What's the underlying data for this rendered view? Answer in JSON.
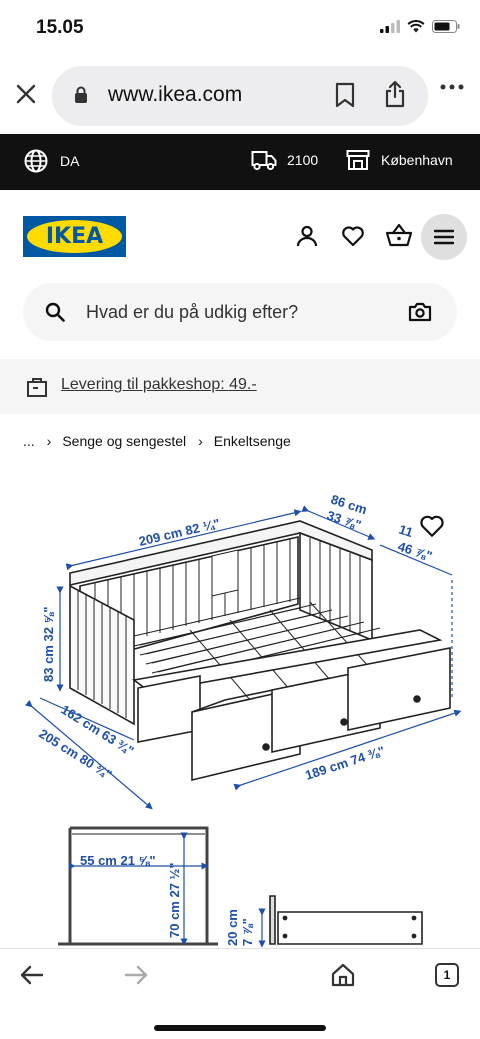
{
  "status": {
    "time": "15.05"
  },
  "browser": {
    "url": "www.ikea.com"
  },
  "topbar": {
    "language": "DA",
    "postcode": "2100",
    "store": "København"
  },
  "header": {
    "logo_text": "IKEA"
  },
  "search": {
    "placeholder": "Hvad er du på udkig efter?"
  },
  "promo": {
    "text": "Levering til pakkeshop: 49.-"
  },
  "breadcrumb": {
    "ellipsis": "...",
    "items": [
      "Senge og sengestel",
      "Enkeltsenge"
    ]
  },
  "diagram": {
    "labels": {
      "top_width": "209 cm 82 ¼\"",
      "depth_top": "86 cm",
      "depth_top_in": "33 ⅞\"",
      "depth_right": "11",
      "depth_right_in": "46 ⅞\"",
      "height": "83 cm 32 ⅝\"",
      "side_a": "162 cm 63 ¾\"",
      "side_b": "205 cm 80 ¾\"",
      "front_length": "189 cm 74 ⅜\"",
      "inner_width": "55 cm 21 ⅝\"",
      "inner_height": "70 cm 27 ½\"",
      "drawer_height": "20 cm",
      "drawer_height_in": "7 ⅞\""
    }
  },
  "bottom_nav": {
    "tabs_count": "1"
  },
  "colors": {
    "topbar": "#111111",
    "ikea_blue": "#0058a3",
    "ikea_yellow": "#ffdb00",
    "dimension_blue": "#1f4fa8"
  }
}
